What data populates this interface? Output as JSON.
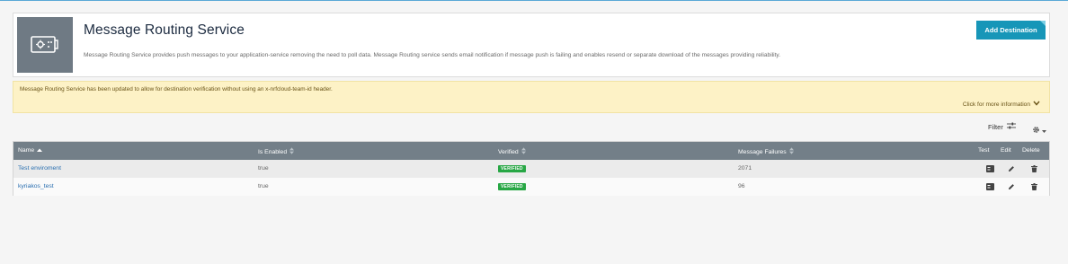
{
  "header": {
    "title": "Message Routing Service",
    "description": "Message Routing Service provides push messages to your application-service removing the need to poll data. Message Routing service sends email notification if message push is failing and enables resend or separate download of the messages providing reliability.",
    "add_button_label": "Add Destination",
    "icon": "routing-card-icon"
  },
  "notice": {
    "text": "Message Routing Service has been updated to allow for destination verification without using an x-nrfcloud-team-id header.",
    "more_label": "Click for more information"
  },
  "toolbar": {
    "filter_label": "Filter",
    "filter_icon": "sliders-icon",
    "settings_icon": "gear-icon"
  },
  "table": {
    "columns": {
      "name": "Name",
      "is_enabled": "Is Enabled",
      "verified": "Verified",
      "message_failures": "Message Failures",
      "test": "Test",
      "edit": "Edit",
      "delete": "Delete"
    },
    "rows": [
      {
        "name": "Test enviroment",
        "is_enabled": "true",
        "verified": "VERIFIED",
        "message_failures": "2071"
      },
      {
        "name": "kyriakos_test",
        "is_enabled": "true",
        "verified": "VERIFIED",
        "message_failures": "96"
      }
    ]
  },
  "colors": {
    "accent": "#1796b8",
    "table_header": "#737f88",
    "verified_badge": "#28a745",
    "notice_bg": "#fdf2c6"
  }
}
